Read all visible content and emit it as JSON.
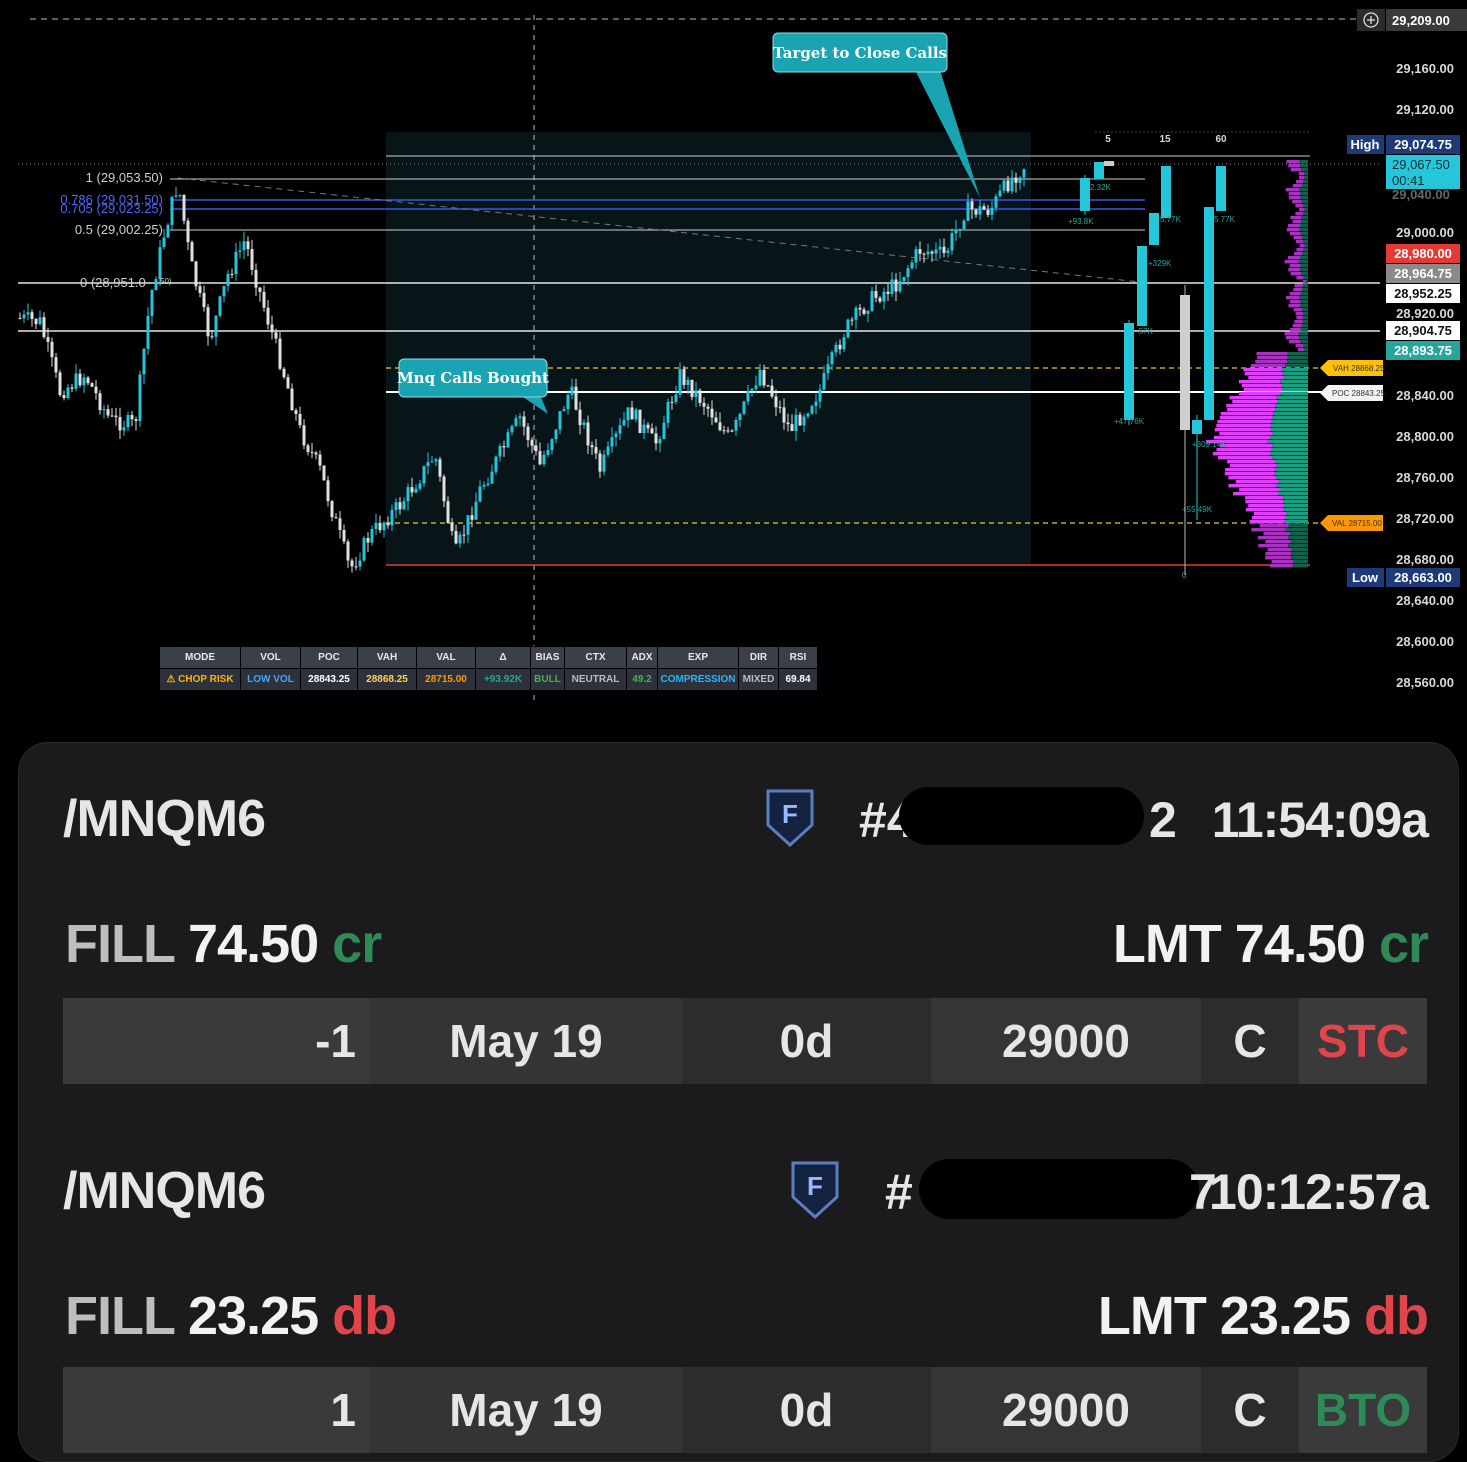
{
  "chart": {
    "price_axis_ticks": [
      "29,209.00",
      "29,160.00",
      "29,120.00",
      "29,000.00",
      "28,920.00",
      "28,840.00",
      "28,800.00",
      "28,760.00",
      "28,720.00",
      "28,680.00",
      "28,640.00",
      "28,600.00",
      "28,560.00"
    ],
    "price_tags": {
      "high_label": "High",
      "high_value": "29,074.75",
      "current_price": "29,067.50",
      "current_countdown": "00:41",
      "tag_red": "28,980.00",
      "tag_gray": "28,964.75",
      "tag_white_1": "28,952.25",
      "tag_white_2": "28,904.75",
      "tag_green": "28,893.75",
      "low_label": "Low",
      "low_value": "28,663.00",
      "partial_hidden": "29,040.00"
    },
    "fib_levels": {
      "fib_1": "1 (29,053.50)",
      "fib_786": "0.786 (29,031.50)",
      "fib_705": "0.705 (29,023.25)",
      "fib_5": "0.5 (29,002.25)",
      "fib_0": "0 (28,951.0",
      "fib_0_tail": "50)"
    },
    "callouts": {
      "target": "Target to Close Calls",
      "bought": "Mnq Calls Bought"
    },
    "timeframes": [
      "5",
      "15",
      "60"
    ],
    "profile_tags": {
      "vah": "VAH 28868.25",
      "poc": "POC 28843.25",
      "val": "VAL 28715.00"
    },
    "bar_delta_labels": [
      "2.32K",
      "+93.8K",
      "5.77K",
      "5.77K",
      "+329K",
      "-57K",
      "+47.76K",
      "+309.14K",
      "+55.49K",
      "0"
    ],
    "colors": {
      "cyan": "#26c6da",
      "teal_callout": "#1aa3b0",
      "magenta": "#e040fb",
      "teal_profile": "#1e9e80",
      "high_tag_bg": "#1e3a78",
      "red_tag": "#e53935",
      "green_tag": "#26a69a"
    }
  },
  "stats": {
    "headers": [
      "MODE",
      "VOL",
      "POC",
      "VAH",
      "VAL",
      "Δ",
      "BIAS",
      "CTX",
      "ADX",
      "EXP",
      "DIR",
      "RSI"
    ],
    "values": [
      "⚠ CHOP RISK",
      "LOW VOL",
      "28843.25",
      "28868.25",
      "28715.00",
      "+93.92K",
      "BULL",
      "NEUTRAL",
      "49.2",
      "COMPRESSION",
      "MIXED",
      "69.84"
    ],
    "value_colors": [
      "#ffb300",
      "#42a5f5",
      "#ffffff",
      "#ffd54f",
      "#ff9800",
      "#26a69a",
      "#4caf50",
      "#bdbdbd",
      "#4caf50",
      "#29b6f6",
      "#bdbdbd",
      "#ffffff"
    ]
  },
  "orders": [
    {
      "symbol": "/MNQM6",
      "badge_letter": "F",
      "order_prefix": "#4",
      "order_suffix": "2",
      "time": "11:54:09a",
      "fill_label": "FILL",
      "fill_price": "74.50",
      "fill_unit": "cr",
      "lmt_label": "LMT",
      "lmt_price": "74.50",
      "lmt_unit": "cr",
      "qty": "-1",
      "expiry": "May 19",
      "dte": "0d",
      "strike": "29000",
      "type": "C",
      "action": "STC"
    },
    {
      "symbol": "/MNQM6",
      "badge_letter": "F",
      "order_prefix": "#",
      "order_suffix": "7",
      "time": "10:12:57a",
      "fill_label": "FILL",
      "fill_price": "23.25",
      "fill_unit": "db",
      "lmt_label": "LMT",
      "lmt_price": "23.25",
      "lmt_unit": "db",
      "qty": "1",
      "expiry": "May 19",
      "dte": "0d",
      "strike": "29000",
      "type": "C",
      "action": "BTO"
    }
  ]
}
